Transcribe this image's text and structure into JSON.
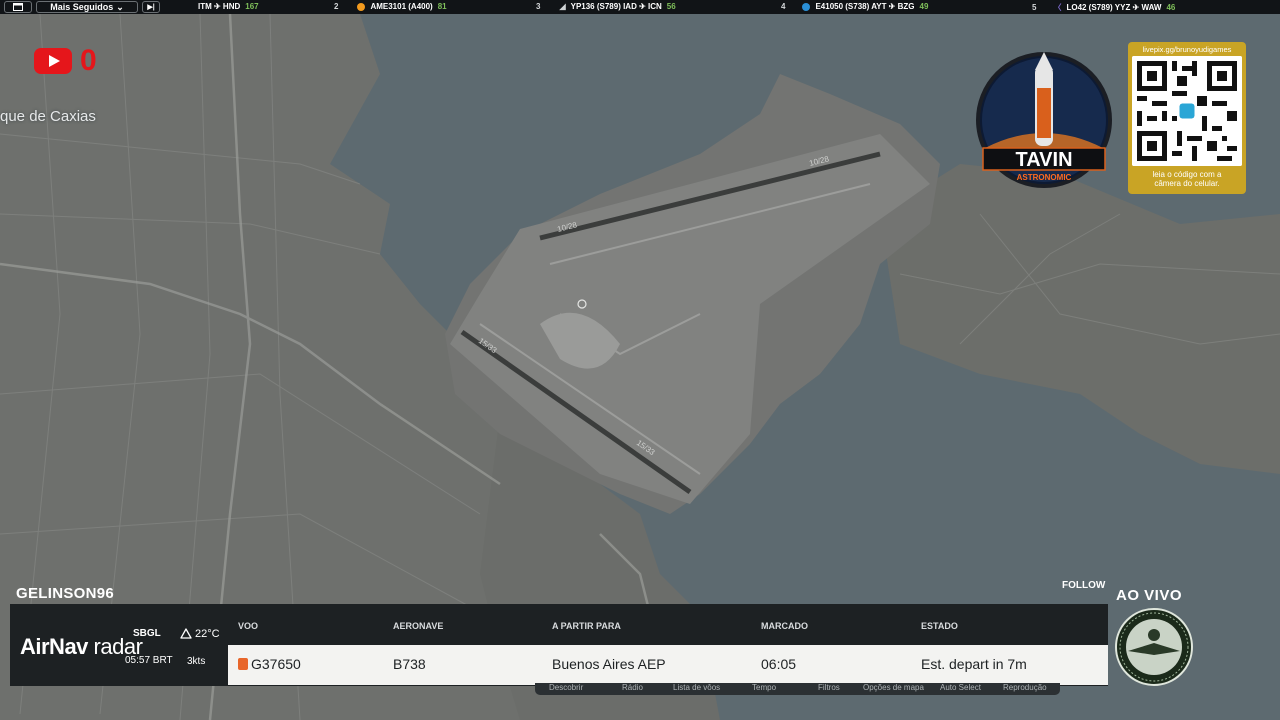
{
  "topbar": {
    "menu_label": "Mais Seguidos",
    "items": [
      {
        "route": "ITM ✈ HND",
        "count": "167"
      },
      {
        "rank": "2",
        "callsign": "AME3101 (A400)",
        "count": "81"
      },
      {
        "rank": "3",
        "callsign": "YP136 (S789) IAD ✈ ICN",
        "count": "56"
      },
      {
        "rank": "4",
        "callsign": "E41050 (S738) AYT ✈ BZG",
        "count": "49"
      },
      {
        "rank": "5",
        "callsign": "LO42 (S789) YYZ ✈ WAW",
        "count": "46"
      }
    ],
    "colors": {
      "green": "#7fbf5a",
      "dot2": "#f29a1e",
      "dot4": "#2a8fd6",
      "dot5": "#7b68c9"
    }
  },
  "map": {
    "place_label": "que de Caxias",
    "runway_labels": [
      "10/28",
      "10/28",
      "15/33",
      "15/33"
    ]
  },
  "overlay": {
    "youtube_count": "0",
    "logo_text": "TAVIN",
    "logo_subtext": "ASTRONOMIC",
    "qr_url": "livepix.gg/brunoyudigames",
    "qr_caption_1": "leia o código com a",
    "qr_caption_2": "câmera do celular."
  },
  "panel": {
    "username": "GELINSON96",
    "follow_label": "FOLLOW",
    "brand_bold": "AirNav",
    "brand_light": "radar",
    "icao": "SBGL",
    "local_time": "05:57 BRT",
    "temperature": "22°C",
    "wind": "3kts",
    "headers": {
      "flight": "VOO",
      "aircraft": "AERONAVE",
      "from_to": "A PARTIR PARA",
      "scheduled": "MARCADO",
      "status": "ESTADO"
    },
    "row": {
      "flight": "G37650",
      "aircraft": "B738",
      "destination": "Buenos Aires AEP",
      "scheduled": "06:05",
      "status": "Est. depart in 7m"
    },
    "toolbar": [
      "Descobrir",
      "Rádio",
      "Lista de vôos",
      "Tempo",
      "Filtros",
      "Opções de mapa",
      "Auto Select",
      "Reprodução"
    ],
    "live_label": "AO VIVO"
  }
}
